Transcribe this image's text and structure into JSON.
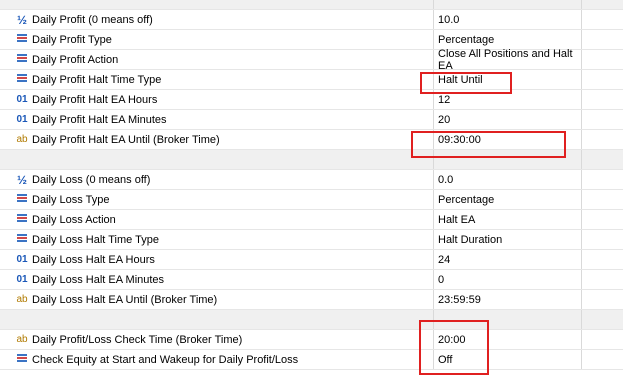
{
  "params": [
    {
      "icon": "fraction-icon",
      "glyph": "½",
      "name": "Daily Profit (0 means off)",
      "value": "10.0"
    },
    {
      "icon": "list-icon",
      "glyph": "",
      "name": "Daily Profit Type",
      "value": "Percentage"
    },
    {
      "icon": "list-icon",
      "glyph": "",
      "name": "Daily Profit Action",
      "value": "Close All Positions and Halt EA"
    },
    {
      "icon": "list-icon",
      "glyph": "",
      "name": "Daily Profit Halt Time Type",
      "value": "Halt Until"
    },
    {
      "icon": "integer-icon",
      "glyph": "01",
      "name": "Daily Profit Halt EA Hours",
      "value": "12"
    },
    {
      "icon": "integer-icon",
      "glyph": "01",
      "name": "Daily Profit Halt EA Minutes",
      "value": "20"
    },
    {
      "icon": "string-icon",
      "glyph": "ab",
      "name": "Daily Profit Halt EA Until (Broker Time)",
      "value": "09:30:00"
    },
    {
      "icon": "fraction-icon",
      "glyph": "½",
      "name": "Daily Loss (0 means off)",
      "value": "0.0"
    },
    {
      "icon": "list-icon",
      "glyph": "",
      "name": "Daily Loss Type",
      "value": "Percentage"
    },
    {
      "icon": "list-icon",
      "glyph": "",
      "name": "Daily Loss Action",
      "value": "Halt EA"
    },
    {
      "icon": "list-icon",
      "glyph": "",
      "name": "Daily Loss Halt Time Type",
      "value": "Halt Duration"
    },
    {
      "icon": "integer-icon",
      "glyph": "01",
      "name": "Daily Loss Halt EA Hours",
      "value": "24"
    },
    {
      "icon": "integer-icon",
      "glyph": "01",
      "name": "Daily Loss Halt EA Minutes",
      "value": "0"
    },
    {
      "icon": "string-icon",
      "glyph": "ab",
      "name": "Daily Loss Halt EA Until (Broker Time)",
      "value": "23:59:59"
    },
    {
      "icon": "string-icon",
      "glyph": "ab",
      "name": "Daily Profit/Loss Check Time (Broker Time)",
      "value": "20:00"
    },
    {
      "icon": "list-icon",
      "glyph": "",
      "name": "Check Equity at Start and Wakeup for Daily Profit/Loss",
      "value": "Off"
    }
  ],
  "colors": {
    "highlight": "#e02020",
    "separator": "#f0f0f0"
  }
}
